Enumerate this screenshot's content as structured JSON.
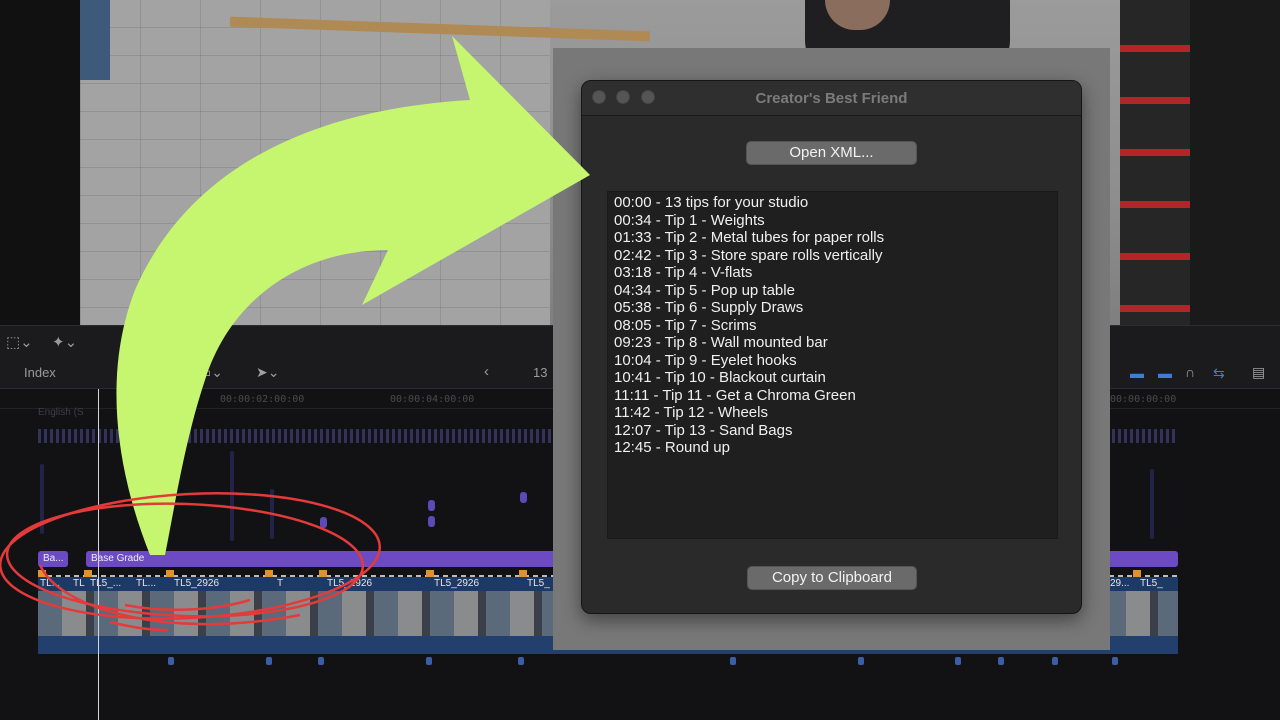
{
  "app": {
    "title": "Creator's Best Friend",
    "open_button": "Open XML...",
    "copy_button": "Copy to Clipboard",
    "chapters": [
      "00:00 - 13 tips for your studio",
      "00:34 - Tip 1 - Weights",
      "01:33 - Tip 2 - Metal tubes for paper rolls",
      "02:42 - Tip 3 - Store spare rolls vertically",
      "03:18 - Tip 4 - V-flats",
      "04:34 - Tip 5 - Pop up table",
      "05:38 - Tip 6 - Supply Draws",
      "08:05 - Tip 7 - Scrims",
      "09:23 - Tip 8 - Wall mounted bar",
      "10:04 - Tip 9 - Eyelet hooks",
      "10:41 - Tip 10 - Blackout curtain",
      "11:11 - Tip 11 - Get a Chroma Green",
      "11:42 - Tip 12 - Wheels",
      "12:07 - Tip 13 - Sand Bags",
      "12:45 - Round up"
    ]
  },
  "editor": {
    "index_label": "Index",
    "timecode_fragment": "13",
    "ruler": [
      "00:00:02:00:00",
      "00:00:04:00:00",
      "00:00:00:00"
    ],
    "caption_lane": "English (S",
    "grade_bars": [
      "Ba...",
      "Base Grade"
    ],
    "clip_labels": [
      "TL...",
      "TL",
      "TL5_...",
      "TL...",
      "TL5_2926",
      "T",
      "TL5_2926",
      "TL5_2926",
      "TL5_",
      "29...",
      "TL5_"
    ]
  },
  "colors": {
    "arrow": "#c6f66f",
    "circle": "#e43a3a",
    "accent": "#3e7bdc",
    "grade": "#6c4ac4",
    "marker": "#e2922b"
  }
}
